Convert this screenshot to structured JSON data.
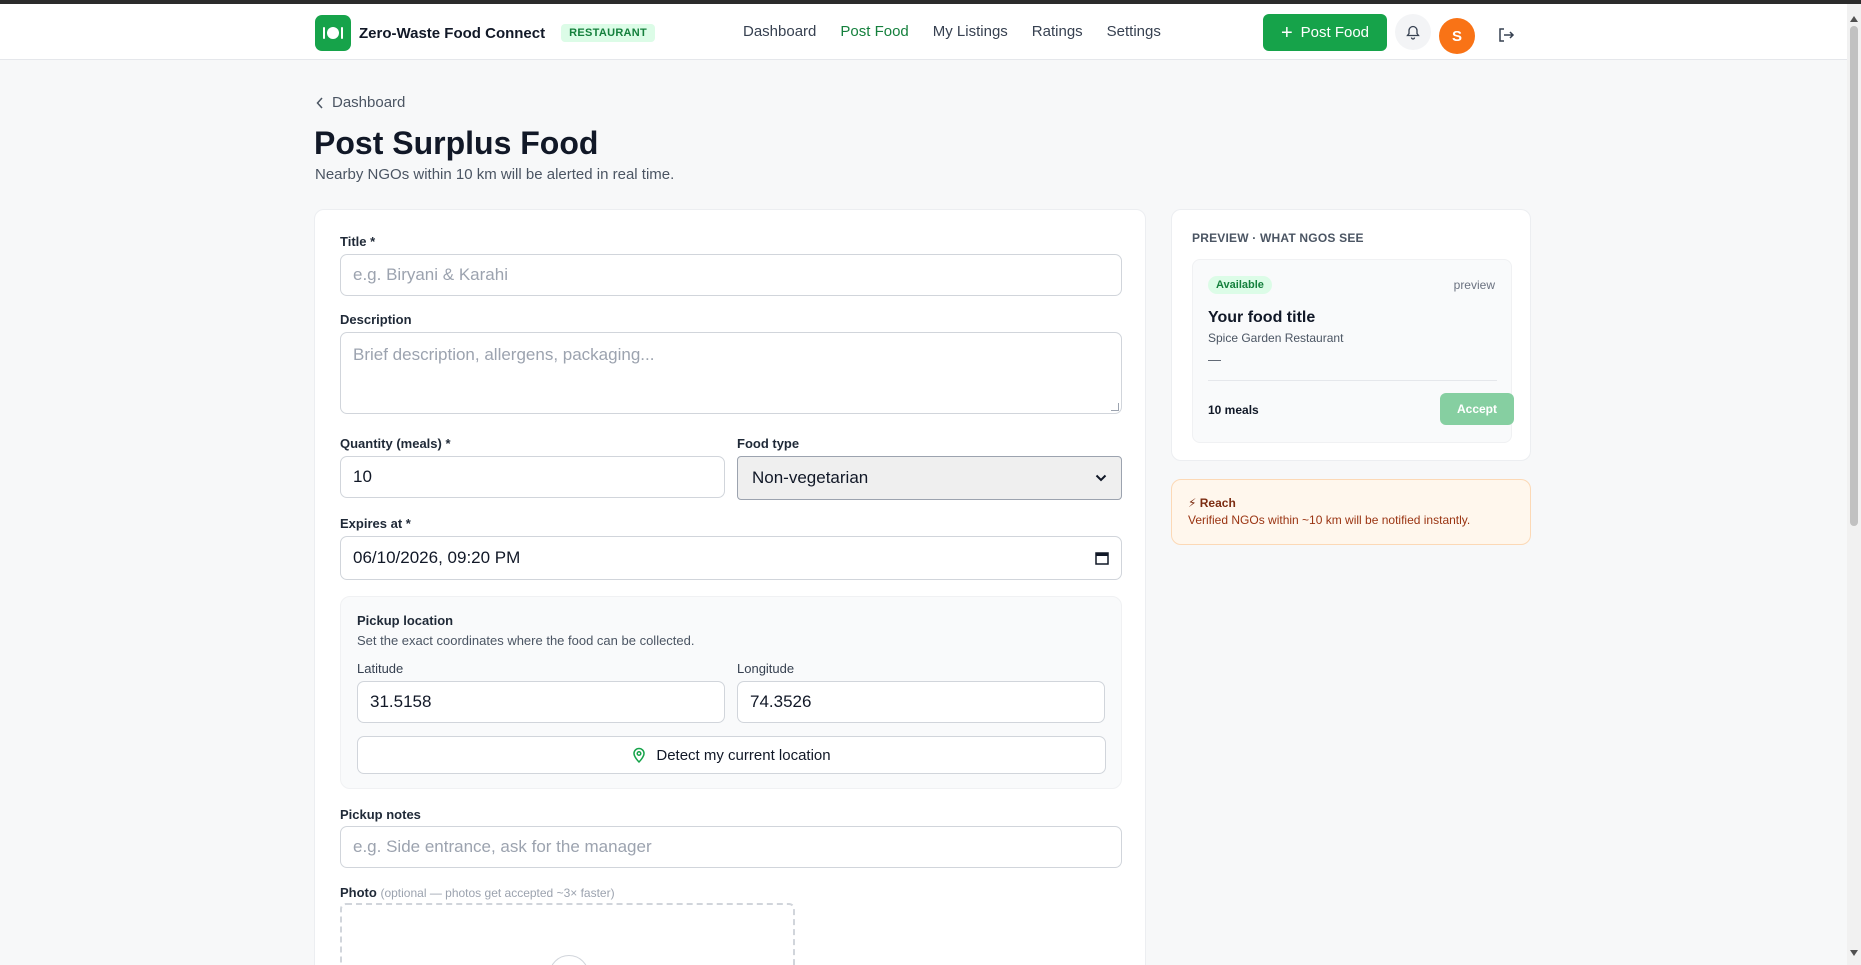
{
  "app": {
    "name": "Zero-Waste Food Connect",
    "role_badge": "RESTAURANT",
    "logo_icon": "plate-utensils-icon",
    "brand_color": "#16a34a"
  },
  "nav": {
    "links": [
      {
        "label": "Dashboard",
        "active": false
      },
      {
        "label": "Post Food",
        "active": true
      },
      {
        "label": "My Listings",
        "active": false
      },
      {
        "label": "Ratings",
        "active": false
      },
      {
        "label": "Settings",
        "active": false
      }
    ],
    "post_button": "Post Food",
    "avatar_initial": "S"
  },
  "breadcrumb": {
    "label": "Dashboard"
  },
  "page": {
    "title": "Post Surplus Food",
    "subtitle": "Nearby NGOs within 10 km will be alerted in real time."
  },
  "form": {
    "title_label": "Title *",
    "title_placeholder": "e.g. Biryani & Karahi",
    "description_label": "Description",
    "description_placeholder": "Brief description, allergens, packaging...",
    "quantity_label": "Quantity (meals) *",
    "quantity_value": "10",
    "food_type_label": "Food type",
    "food_type_value": "Non-vegetarian",
    "expires_label": "Expires at *",
    "expires_value": "06/10/2026, 09:20 PM",
    "pickup": {
      "title": "Pickup location",
      "subtitle": "Set the exact coordinates where the food can be collected.",
      "latitude_label": "Latitude",
      "latitude_value": "31.5158",
      "longitude_label": "Longitude",
      "longitude_value": "74.3526",
      "detect_button": "Detect my current location"
    },
    "notes_label": "Pickup notes",
    "notes_placeholder": "e.g. Side entrance, ask for the manager",
    "photo_label": "Photo",
    "photo_hint": "(optional — photos get accepted ~3× faster)"
  },
  "preview": {
    "heading": "PREVIEW · WHAT NGOS SEE",
    "status_badge": "Available",
    "tag": "preview",
    "food_title": "Your food title",
    "restaurant": "Spice Garden Restaurant",
    "placeholder_dash": "—",
    "meals": "10 meals",
    "accept_button": "Accept"
  },
  "reach": {
    "title": "⚡ Reach",
    "text": "Verified NGOs within ~10 km will be notified instantly."
  }
}
